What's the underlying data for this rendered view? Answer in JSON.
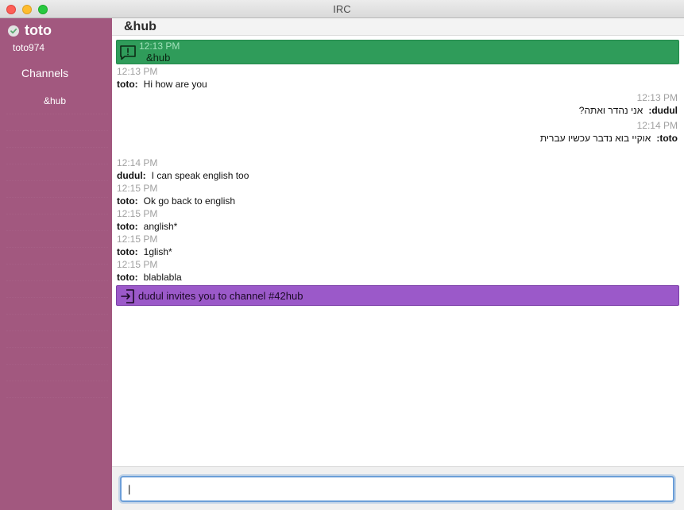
{
  "window": {
    "title": "IRC"
  },
  "sidebar": {
    "user_name": "toto",
    "user_handle": "toto974",
    "channels_heading": "Channels",
    "channels": [
      "&hub"
    ]
  },
  "channel": {
    "title": "&hub"
  },
  "messages": [
    {
      "time": "12:13 PM",
      "nick": "toto:",
      "text": "Hi how are you",
      "rtl": false
    },
    {
      "time": "12:13 PM",
      "nick": "dudul:",
      "text": "אני נהדר ואתה?",
      "rtl": true
    },
    {
      "time": "12:14 PM",
      "nick": "toto:",
      "text": "אוקיי בוא נדבר עכשיו עברית",
      "rtl": true
    },
    {
      "time": "12:14 PM",
      "nick": "dudul:",
      "text": "I can speak english too",
      "rtl": false
    },
    {
      "time": "12:15 PM",
      "nick": "toto:",
      "text": "Ok go back to english",
      "rtl": false
    },
    {
      "time": "12:15 PM",
      "nick": "toto:",
      "text": "anglish*",
      "rtl": false
    },
    {
      "time": "12:15 PM",
      "nick": "toto:",
      "text": "1glish*",
      "rtl": false
    },
    {
      "time": "12:15 PM",
      "nick": "toto:",
      "text": "blablabla",
      "rtl": false
    }
  ],
  "join_banner": {
    "time": "12:13 PM",
    "text": "&hub"
  },
  "invite_banner": {
    "text": "dudul invites you to channel #42hub"
  },
  "composer": {
    "value": "|"
  },
  "colors": {
    "sidebar": "#a2587f",
    "join_banner": "#2f9c5a",
    "invite_banner": "#9b59c9",
    "input_focus": "#6b9ed8"
  },
  "icons": {
    "status": "check-circle-icon",
    "join": "chat-alert-icon",
    "invite": "enter-icon"
  }
}
